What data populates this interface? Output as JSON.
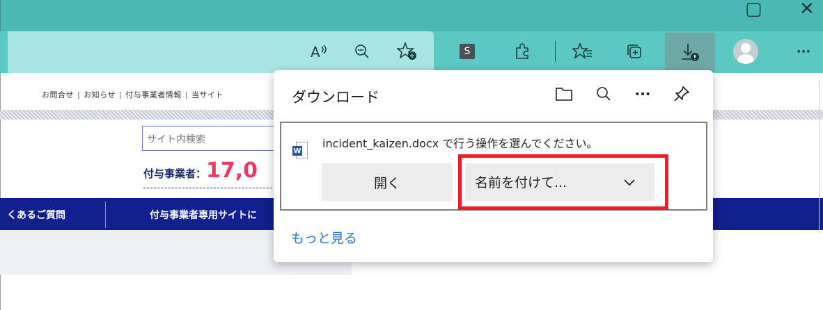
{
  "browser": {
    "toolbar_icons": [
      "read-aloud-icon",
      "zoom-icon",
      "add-favorite-icon",
      "extension-s-icon",
      "extensions-icon",
      "favorites-icon",
      "collections-icon",
      "downloads-icon",
      "profile-avatar",
      "more-icon"
    ],
    "s_badge": "S",
    "more_glyph": "···"
  },
  "page": {
    "top_links": [
      "お問合せ",
      "お知らせ",
      "付与事業者情報",
      "当サイト"
    ],
    "search_placeholder": "サイト内検索",
    "cert_label": "付与事業者：",
    "cert_number": "17,0",
    "nav": [
      "くあるご質問",
      "付与事業者専用サイトに"
    ]
  },
  "download_panel": {
    "title": "ダウンロード",
    "file_message": "incident_kaizen.docx で行う操作を選んでください。",
    "word_badge": "W",
    "open_label": "開く",
    "save_as_label": "名前を付けて...",
    "more_link": "もっと見る"
  },
  "colors": {
    "titlebar": "#4ab9b5",
    "toolbar": "#5cc8c4",
    "navbar": "#12208e",
    "highlight": "#ee1c25",
    "link": "#2a73c9",
    "cert_number": "#e53c63"
  }
}
